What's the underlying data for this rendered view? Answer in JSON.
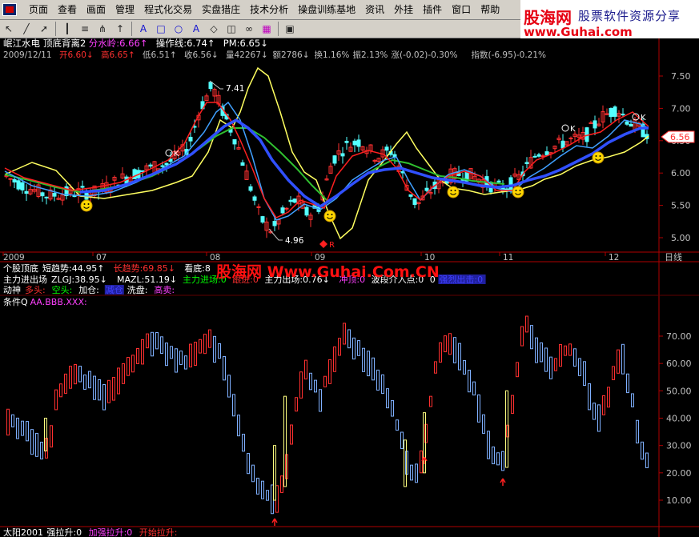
{
  "menu": [
    "页面",
    "查看",
    "画面",
    "管理",
    "程式化交易",
    "实盘猎庄",
    "技术分析",
    "操盘训练基地",
    "资讯",
    "外挂",
    "插件",
    "窗口",
    "帮助"
  ],
  "logo": {
    "brand": "股海网",
    "tagline": "股票软件资源分享",
    "url": "www.Guhai.com"
  },
  "toolbar_icons": [
    "cursor-icon",
    "line-icon",
    "arrow-icon",
    "bars-icon",
    "list-icon",
    "fork-icon",
    "up-arrow-icon",
    "text-icon",
    "rect-icon",
    "circle-icon",
    "text-tool-icon",
    "shape-icon",
    "eraser-icon",
    "link-icon",
    "colors-icon",
    "save-icon"
  ],
  "main_chart": {
    "title_parts": [
      {
        "text": "岷江水电",
        "color": "#ffffff"
      },
      {
        "text": "顶底背离2",
        "color": "#ffffff"
      },
      {
        "text": "分水岭:6.66↑",
        "color": "#ff40ff"
      },
      {
        "text": "操作线:6.74↑",
        "color": "#ffffff"
      },
      {
        "text": "PM:6.65↓",
        "color": "#ffffff"
      }
    ],
    "info_parts": [
      {
        "text": "2009/12/11",
        "color": "#c0c0c0"
      },
      {
        "text": "开6.60↓",
        "color": "#ff3030"
      },
      {
        "text": "高6.65↑",
        "color": "#ff3030"
      },
      {
        "text": "低6.51↑",
        "color": "#c0c0c0"
      },
      {
        "text": "收6.56↓",
        "color": "#c0c0c0"
      },
      {
        "text": "量42267↓",
        "color": "#c0c0c0"
      },
      {
        "text": "额2786↓",
        "color": "#c0c0c0"
      },
      {
        "text": "换1.16%",
        "color": "#c0c0c0"
      },
      {
        "text": "振2.13%",
        "color": "#c0c0c0"
      },
      {
        "text": "涨(-0.02)-0.30%",
        "color": "#c0c0c0"
      },
      {
        "text": "指数(-6.95)-0.21%",
        "color": "#c0c0c0"
      }
    ],
    "y_ticks": [
      "7.50",
      "7.00",
      "6.50",
      "6.00",
      "5.50",
      "5.00"
    ],
    "current_price": "6.56",
    "annotations": {
      "high": "7.41",
      "low": "4.96",
      "k_markers": [
        "K",
        "K",
        "K",
        "K"
      ],
      "r_marker": "R"
    },
    "x_labels": [
      "2009",
      "07",
      "08",
      "09",
      "10",
      "11",
      "12"
    ],
    "period": "日线"
  },
  "indicators": [
    {
      "name": "ind-bottom-top",
      "parts": [
        {
          "text": "个股顶底",
          "color": "#ffffff"
        },
        {
          "text": "短趋势:44.95↑",
          "color": "#ffffff"
        },
        {
          "text": "长趋势:69.85↓",
          "color": "#ff3030"
        },
        {
          "text": "看底:8",
          "color": "#ffffff"
        }
      ]
    },
    {
      "name": "ind-main-force",
      "parts": [
        {
          "text": "主力进出场",
          "color": "#ffffff"
        },
        {
          "text": "ZLGJ:38.95↓",
          "color": "#ffffff"
        },
        {
          "text": "MAZL:51.19↓",
          "color": "#ffffff"
        },
        {
          "text": "主力进场:0",
          "color": "#00ff00"
        },
        {
          "text": "跟进:0",
          "color": "#ff3030"
        },
        {
          "text": "主力出场:0.76↓",
          "color": "#ffffff"
        },
        {
          "text": "冲顶:0",
          "color": "#ff40ff"
        },
        {
          "text": "波段介入点:0",
          "color": "#ffffff"
        },
        {
          "text": "0",
          "color": "#ffffff"
        },
        {
          "text": "强烈出击:0",
          "color": "#4040ff"
        }
      ]
    },
    {
      "name": "ind-momentum",
      "parts": [
        {
          "text": "动神",
          "color": "#ffffff"
        },
        {
          "text": "多头:",
          "color": "#ff3030"
        },
        {
          "text": "空头:",
          "color": "#00ff00"
        },
        {
          "text": "加仓:",
          "color": "#ffffff"
        },
        {
          "text": "减仓",
          "color": "#4040ff"
        },
        {
          "text": "洗盘:",
          "color": "#ffffff"
        },
        {
          "text": "高卖:",
          "color": "#ff40ff"
        }
      ]
    },
    {
      "name": "ind-condition",
      "parts": [
        {
          "text": "条件Q",
          "color": "#ffffff"
        },
        {
          "text": "AA.BBB.XXX:",
          "color": "#ff40ff"
        }
      ]
    }
  ],
  "lower_chart": {
    "y_ticks": [
      "70.00",
      "60.00",
      "50.00",
      "40.00",
      "30.00",
      "20.00",
      "10.00"
    ]
  },
  "bottom_line": [
    {
      "text": "太阳2001",
      "color": "#ffffff"
    },
    {
      "text": "强拉升:0",
      "color": "#ffffff"
    },
    {
      "text": "加强拉升:0",
      "color": "#ff40ff"
    },
    {
      "text": "开始拉升:",
      "color": "#ff3030"
    }
  ],
  "watermark": "股海网 Www.Guhai.Com.CN",
  "colors": {
    "up": "#ff3030",
    "down": "#54ffff",
    "ma_red": "#ff2020",
    "ma_blue": "#3050ff",
    "ma_green": "#30c030",
    "ma_yellow": "#ffff60",
    "ma_cyan": "#40a0ff"
  }
}
